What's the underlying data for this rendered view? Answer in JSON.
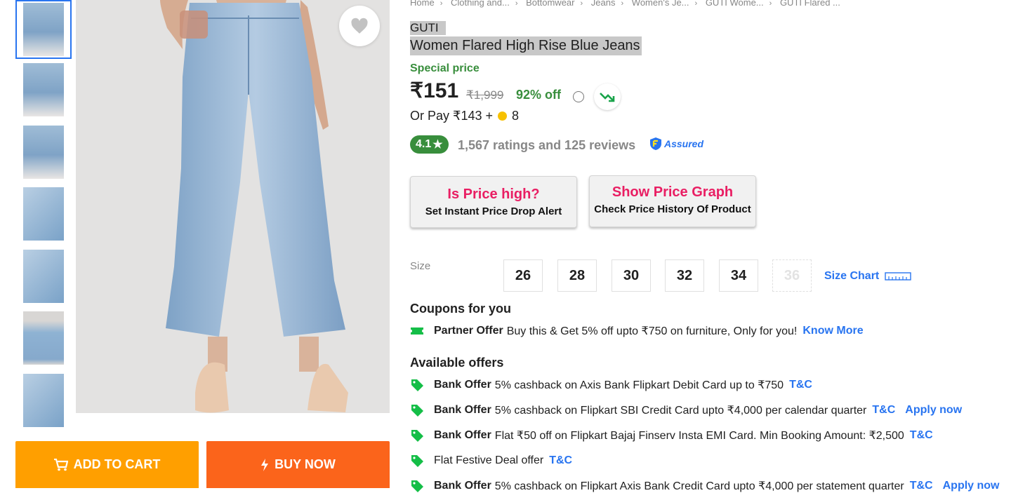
{
  "breadcrumb": [
    "Home",
    "Clothing and...",
    "Bottomwear",
    "Jeans",
    "Women's Je...",
    "GUTI Wome...",
    "GUTI Flared ..."
  ],
  "product": {
    "brand": "GUTI",
    "title": "Women Flared High Rise Blue Jeans",
    "special_label": "Special price",
    "price": "₹151",
    "mrp": "₹1,999",
    "discount": "92% off",
    "or_pay": "Or Pay ₹143 +",
    "coins": "8",
    "rating": "4.1",
    "rating_star": "★",
    "ratings_text": "1,567 ratings and 125 reviews",
    "assured": "Assured"
  },
  "price_tools": [
    {
      "heading": "Is Price high?",
      "sub": "Set Instant Price Drop Alert"
    },
    {
      "heading": "Show Price Graph",
      "sub": "Check Price History Of Product"
    }
  ],
  "size": {
    "label": "Size",
    "options": [
      "26",
      "28",
      "30",
      "32",
      "34",
      "36"
    ],
    "unavailable": [
      "36"
    ],
    "chart_link": "Size Chart"
  },
  "coupons": {
    "heading": "Coupons for you",
    "items": [
      {
        "title": "Partner Offer",
        "text": "Buy this & Get 5% off upto ₹750 on furniture, Only for you!",
        "link": "Know More"
      }
    ]
  },
  "offers": {
    "heading": "Available offers",
    "items": [
      {
        "title": "Bank Offer",
        "text": "5% cashback on Axis Bank Flipkart Debit Card up to ₹750",
        "tc": "T&C",
        "extra": ""
      },
      {
        "title": "Bank Offer",
        "text": "5% cashback on Flipkart SBI Credit Card upto ₹4,000 per calendar quarter",
        "tc": "T&C",
        "extra": "Apply now"
      },
      {
        "title": "Bank Offer",
        "text": "Flat ₹50 off on Flipkart Bajaj Finserv Insta EMI Card. Min Booking Amount: ₹2,500",
        "tc": "T&C",
        "extra": ""
      },
      {
        "title": "",
        "text": "Flat Festive Deal offer",
        "tc": "T&C",
        "extra": ""
      },
      {
        "title": "Bank Offer",
        "text": "5% cashback on Flipkart Axis Bank Credit Card upto ₹4,000 per statement quarter",
        "tc": "T&C",
        "extra": "Apply now"
      }
    ]
  },
  "actions": {
    "add_to_cart": "ADD TO CART",
    "buy_now": "BUY NOW"
  },
  "icons": {
    "wishlist": "heart-icon",
    "cart": "cart-icon",
    "buy": "lightning-icon",
    "info": "info-icon",
    "trend": "trend-down-icon",
    "coin": "supercoin-icon",
    "assured": "assured-badge-icon",
    "size_chart": "ruler-icon",
    "coupon": "coupon-ticket-icon",
    "offer": "offer-tag-icon"
  },
  "colors": {
    "accent": "#2874f0",
    "green": "#388e3c",
    "cart": "#ff9f00",
    "buy": "#fb641b",
    "pink": "#e91e63"
  }
}
